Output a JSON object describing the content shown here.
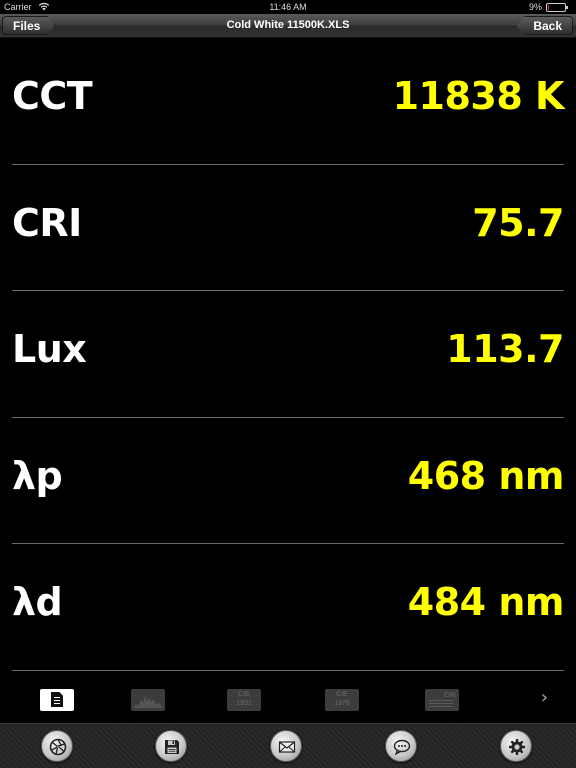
{
  "status_bar": {
    "carrier": "Carrier",
    "time": "11:46 AM",
    "battery_percent": "9%",
    "battery_level": 0.09,
    "battery_color": "#e33333"
  },
  "nav_bar": {
    "left_button": "Files",
    "title": "Cold White 11500K.XLS",
    "right_button": "Back"
  },
  "metrics": [
    {
      "label": "CCT",
      "value": "11838 K"
    },
    {
      "label": "CRI",
      "value": "75.7"
    },
    {
      "label": "Lux",
      "value": "113.7"
    },
    {
      "label": "λp",
      "value": "468 nm"
    },
    {
      "label": "λd",
      "value": "484 nm"
    }
  ],
  "colors": {
    "value_color": "#ffff00",
    "label_color": "#ffffff",
    "background": "#000000"
  },
  "tabs": {
    "active": "summary",
    "cie1931": {
      "line1": "CIE",
      "line2": "1931"
    },
    "cie1976": {
      "line1": "CIE",
      "line2": "1976"
    },
    "cri": {
      "label": "CRI"
    },
    "next_icon": "chevron-right-icon"
  },
  "toolbar": {
    "icons": [
      "aperture-icon",
      "floppy-disk-icon",
      "envelope-icon",
      "speech-bubble-icon",
      "gear-icon"
    ]
  }
}
